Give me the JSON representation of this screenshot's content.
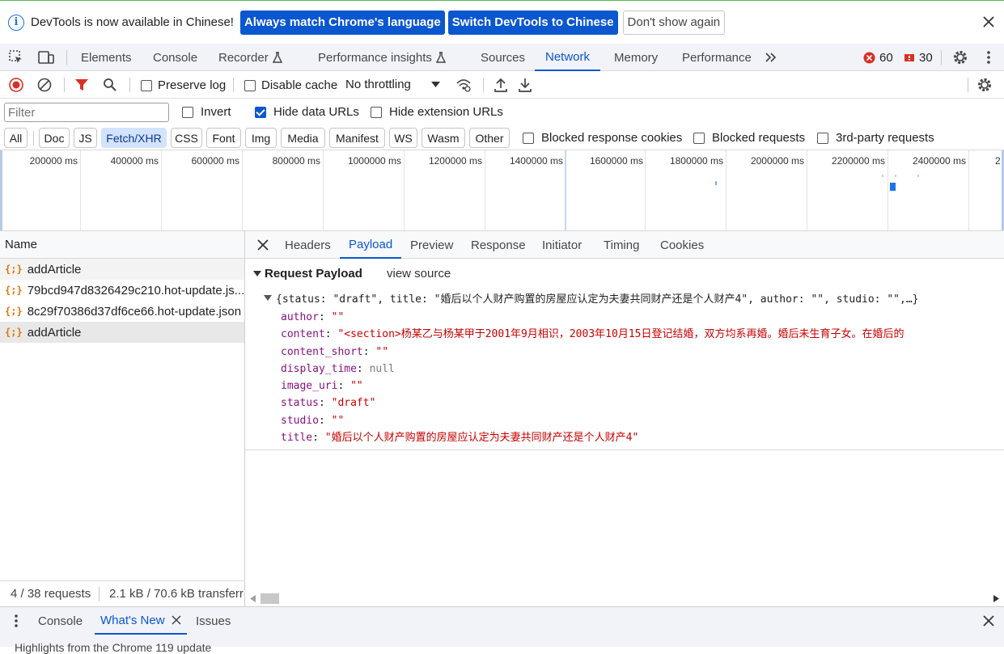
{
  "infobar": {
    "message": "DevTools is now available in Chinese!",
    "match_button": "Always match Chrome's language",
    "switch_button": "Switch DevTools to Chinese",
    "dismiss_button": "Don't show again"
  },
  "main_tabs": [
    "Elements",
    "Console",
    "Recorder",
    "Performance insights",
    "Sources",
    "Network",
    "Memory",
    "Performance"
  ],
  "active_main_tab": "Network",
  "counts": {
    "errors": "60",
    "issues": "30"
  },
  "toolbar": {
    "preserve_log": "Preserve log",
    "disable_cache": "Disable cache",
    "throttling": "No throttling"
  },
  "filter": {
    "placeholder": "Filter",
    "invert": "Invert",
    "hide_data_urls": "Hide data URLs",
    "hide_extension_urls": "Hide extension URLs"
  },
  "type_filters": [
    "All",
    "Doc",
    "JS",
    "Fetch/XHR",
    "CSS",
    "Font",
    "Img",
    "Media",
    "Manifest",
    "WS",
    "Wasm",
    "Other"
  ],
  "active_type_filter": "Fetch/XHR",
  "extra_filters": [
    "Blocked response cookies",
    "Blocked requests",
    "3rd-party requests"
  ],
  "timeline_ticks": [
    "200000 ms",
    "400000 ms",
    "600000 ms",
    "800000 ms",
    "1000000 ms",
    "1200000 ms",
    "1400000 ms",
    "1600000 ms",
    "1800000 ms",
    "2000000 ms",
    "2200000 ms",
    "2400000 ms",
    "2"
  ],
  "requests": {
    "header": "Name",
    "items": [
      "addArticle",
      "79bcd947d8326429c210.hot-update.js...",
      "8c29f70386d37df6ce66.hot-update.json",
      "addArticle"
    ]
  },
  "status": {
    "requests": "4 / 38 requests",
    "transferred": "2.1 kB / 70.6 kB transferre"
  },
  "detail_tabs": [
    "Headers",
    "Payload",
    "Preview",
    "Response",
    "Initiator",
    "Timing",
    "Cookies"
  ],
  "active_detail_tab": "Payload",
  "payload": {
    "section_title": "Request Payload",
    "view_source": "view source",
    "summary": "{status: \"draft\", title: \"婚后以个人财产购置的房屋应认定为夫妻共同财产还是个人财产4\", author: \"\", studio: \"\",…}",
    "fields": [
      {
        "key": "author",
        "value": "\"\"",
        "kind": "str"
      },
      {
        "key": "content",
        "value": "\"<section>杨某乙与杨某甲于2001年9月相识，2003年10月15日登记结婚，双方均系再婚。婚后未生育子女。在婚后的",
        "kind": "str"
      },
      {
        "key": "content_short",
        "value": "\"\"",
        "kind": "str"
      },
      {
        "key": "display_time",
        "value": "null",
        "kind": "nul"
      },
      {
        "key": "image_uri",
        "value": "\"\"",
        "kind": "str"
      },
      {
        "key": "status",
        "value": "\"draft\"",
        "kind": "str"
      },
      {
        "key": "studio",
        "value": "\"\"",
        "kind": "str"
      },
      {
        "key": "title",
        "value": "\"婚后以个人财产购置的房屋应认定为夫妻共同财产还是个人财产4\"",
        "kind": "str"
      }
    ]
  },
  "drawer": {
    "tabs": [
      "Console",
      "What's New",
      "Issues"
    ],
    "active_tab": "What's New",
    "peek_text": "Highlights from the Chrome 119 update"
  },
  "colors": {
    "accent": "#0b57d0",
    "error": "#d93025",
    "xhr_icon": "#e37400"
  }
}
